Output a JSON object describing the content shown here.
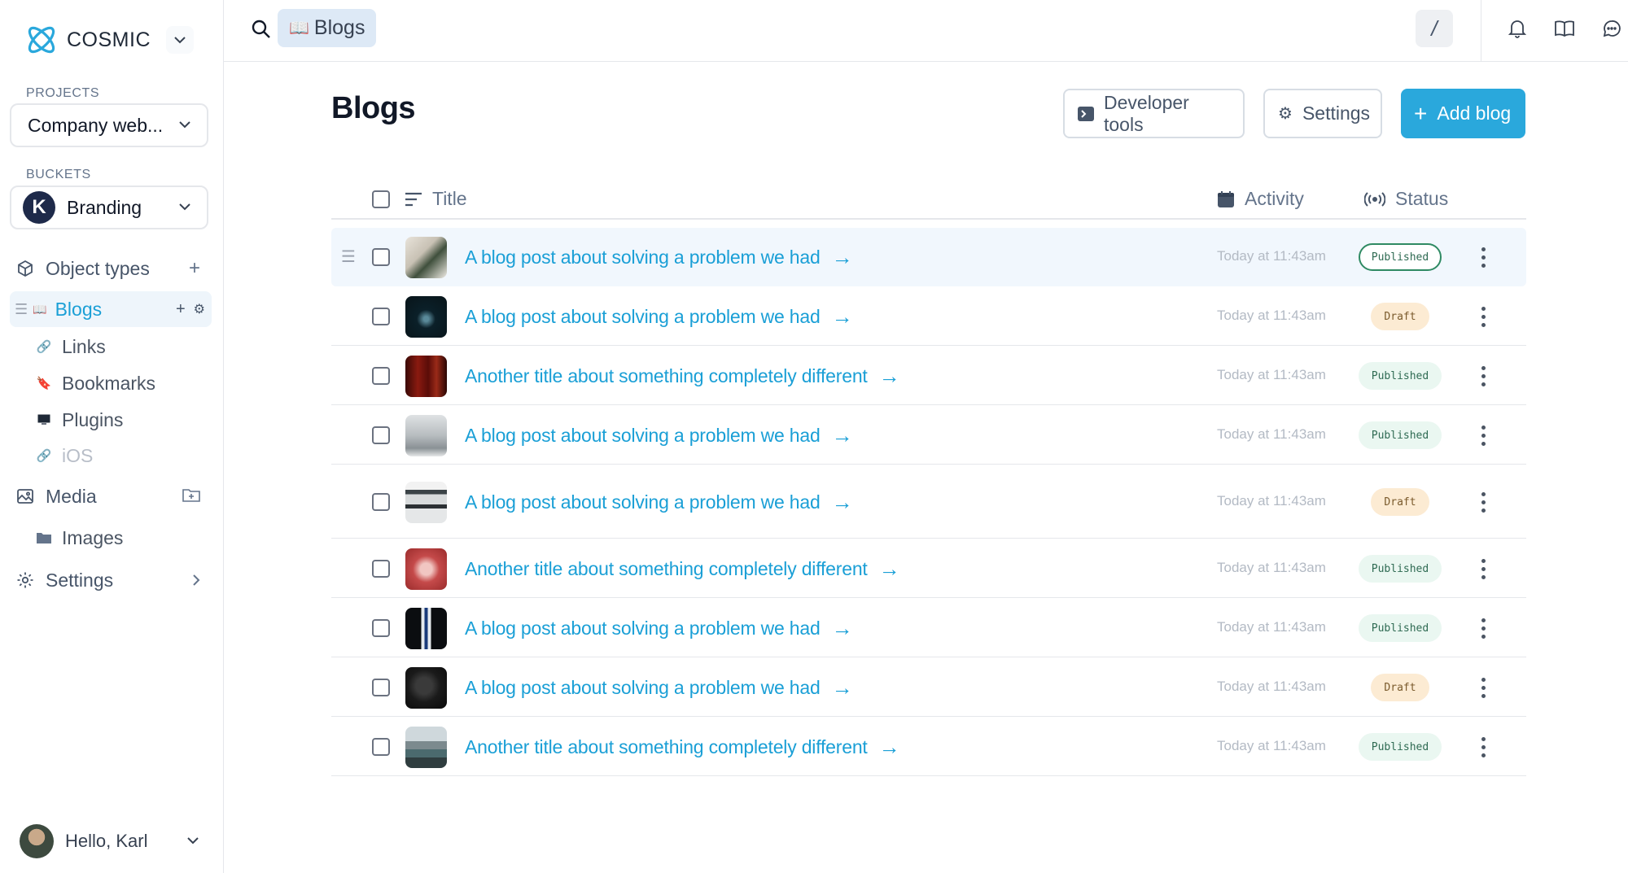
{
  "brand": {
    "name": "COSMIC"
  },
  "sidebar": {
    "projects_label": "PROJECTS",
    "project": "Company web...",
    "buckets_label": "BUCKETS",
    "bucket_initial": "K",
    "bucket": "Branding",
    "object_types_label": "Object types",
    "object_types": [
      {
        "label": "Blogs",
        "icon": "book-icon",
        "active": true
      },
      {
        "label": "Links",
        "icon": "link-icon"
      },
      {
        "label": "Bookmarks",
        "icon": "bookmark-icon"
      },
      {
        "label": "Plugins",
        "icon": "computer-icon"
      },
      {
        "label": "iOS",
        "icon": "link-icon"
      }
    ],
    "media_label": "Media",
    "media_items": [
      {
        "label": "Images",
        "icon": "folder-icon"
      }
    ],
    "settings_label": "Settings",
    "user_greeting": "Hello, Karl"
  },
  "topbar": {
    "breadcrumb": "Blogs",
    "shortcut": "/"
  },
  "page": {
    "title": "Blogs",
    "developer_tools": "Developer tools",
    "settings": "Settings",
    "add": "Add blog"
  },
  "table": {
    "columns": {
      "title": "Title",
      "activity": "Activity",
      "status": "Status"
    },
    "rows": [
      {
        "title": "A blog post about solving a problem we had",
        "activity": "Today at 11:43am",
        "status": "Published",
        "highlighted": true
      },
      {
        "title": "A blog post about solving a problem we had",
        "activity": "Today at 11:43am",
        "status": "Draft"
      },
      {
        "title": "Another title about something completely different",
        "activity": "Today at 11:43am",
        "status": "Published"
      },
      {
        "title": "A blog post about solving a problem we had",
        "activity": "Today at 11:43am",
        "status": "Published"
      },
      {
        "title": "A blog post about solving a problem we had",
        "activity": "Today at 11:43am",
        "status": "Draft"
      },
      {
        "title": "Another title about something completely different",
        "activity": "Today at 11:43am",
        "status": "Published"
      },
      {
        "title": "A blog post about solving a problem we had",
        "activity": "Today at 11:43am",
        "status": "Published"
      },
      {
        "title": "A blog post about solving a problem we had",
        "activity": "Today at 11:43am",
        "status": "Draft"
      },
      {
        "title": "Another title about something completely different",
        "activity": "Today at 11:43am",
        "status": "Published"
      }
    ]
  },
  "colors": {
    "accent": "#2aa8dc",
    "link": "#1a9fd6",
    "published": "#eaf7f1",
    "draft": "#fcebd3"
  }
}
